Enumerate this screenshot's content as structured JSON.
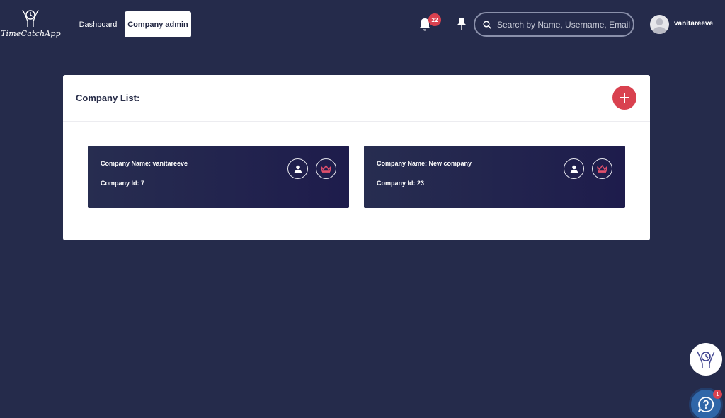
{
  "header": {
    "logo_text": "TimeCatchApp",
    "nav": {
      "dashboard": "Dashboard",
      "company_admin": "Company admin"
    },
    "notifications_count": "22",
    "search": {
      "placeholder": "Search by Name, Username, Email"
    },
    "user": {
      "name": "vanitareeve"
    }
  },
  "main": {
    "title": "Company List:",
    "add_icon": "plus-icon",
    "companies": [
      {
        "name_label": "Company Name: vanitareeve",
        "id_label": "Company Id: 7"
      },
      {
        "name_label": "Company Name: New company",
        "id_label": "Company Id: 23"
      }
    ]
  },
  "floating": {
    "help_badge": "1"
  },
  "colors": {
    "background": "#252b4b",
    "accent": "#d9414f",
    "card": "#272d50",
    "help": "#2f66a8"
  }
}
